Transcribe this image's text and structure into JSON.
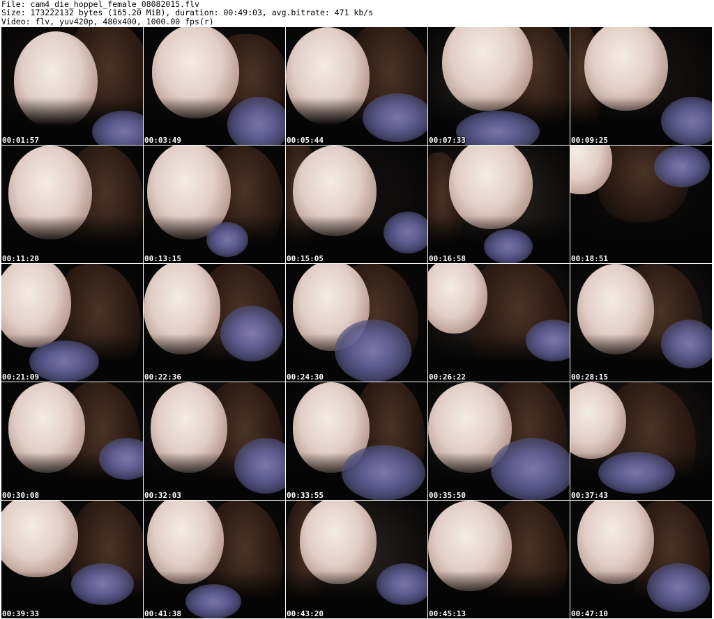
{
  "header": {
    "file_line": "File: cam4_die_hoppel_female_08082015.flv",
    "size_line": "Size: 173222132 bytes (165.20 MiB), duration: 00:49:03, avg.bitrate: 471 kb/s",
    "video_line": "Video: flv, yuv420p, 480x400, 1000.00 fps(r)"
  },
  "thumbnails": [
    {
      "timestamp": "00:01:57"
    },
    {
      "timestamp": "00:03:49"
    },
    {
      "timestamp": "00:05:44"
    },
    {
      "timestamp": "00:07:33"
    },
    {
      "timestamp": "00:09:25"
    },
    {
      "timestamp": "00:11:20"
    },
    {
      "timestamp": "00:13:15"
    },
    {
      "timestamp": "00:15:05"
    },
    {
      "timestamp": "00:16:58"
    },
    {
      "timestamp": "00:18:51"
    },
    {
      "timestamp": "00:21:09"
    },
    {
      "timestamp": "00:22:36"
    },
    {
      "timestamp": "00:24:30"
    },
    {
      "timestamp": "00:26:22"
    },
    {
      "timestamp": "00:28:15"
    },
    {
      "timestamp": "00:30:08"
    },
    {
      "timestamp": "00:32:03"
    },
    {
      "timestamp": "00:33:55"
    },
    {
      "timestamp": "00:35:50"
    },
    {
      "timestamp": "00:37:43"
    },
    {
      "timestamp": "00:39:33"
    },
    {
      "timestamp": "00:41:38"
    },
    {
      "timestamp": "00:43:20"
    },
    {
      "timestamp": "00:45:13"
    },
    {
      "timestamp": "00:47:10"
    }
  ]
}
